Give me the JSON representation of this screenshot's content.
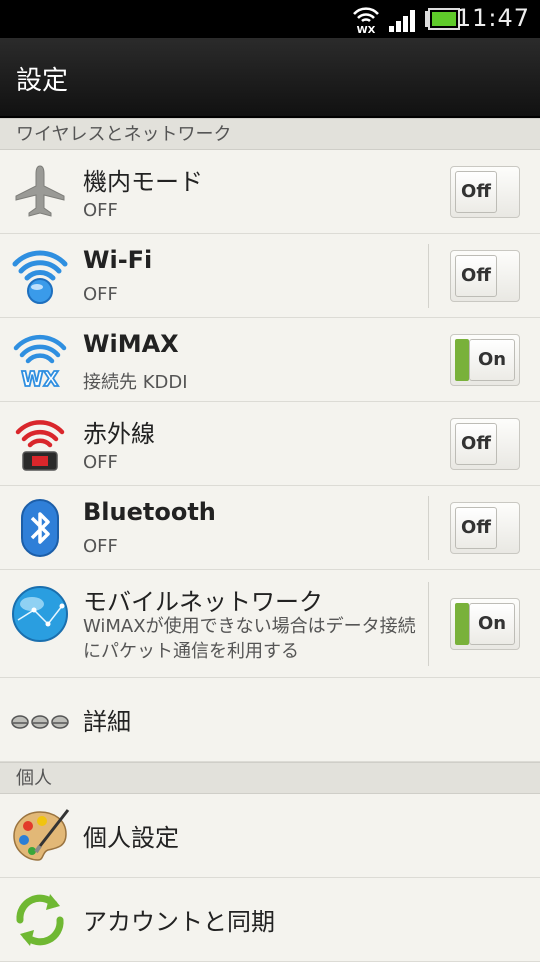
{
  "status_bar": {
    "time": "11:47",
    "network_label": "WX"
  },
  "action_bar": {
    "title": "設定"
  },
  "sections": {
    "wireless": {
      "header": "ワイヤレスとネットワーク",
      "items": [
        {
          "title": "機内モード",
          "subtitle": "OFF",
          "toggle": "Off",
          "icon": "airplane-icon"
        },
        {
          "title": "Wi-Fi",
          "subtitle": "OFF",
          "toggle": "Off",
          "icon": "wifi-icon"
        },
        {
          "title": "WiMAX",
          "subtitle": "接続先 KDDI",
          "toggle": "On",
          "icon": "wimax-icon"
        },
        {
          "title": "赤外線",
          "subtitle": "OFF",
          "toggle": "Off",
          "icon": "infrared-icon"
        },
        {
          "title": "Bluetooth",
          "subtitle": "OFF",
          "toggle": "Off",
          "icon": "bluetooth-icon"
        },
        {
          "title": "モバイルネットワーク",
          "subtitle": "WiMAXが使用できない場合はデータ接続にパケット通信を利用する",
          "toggle": "On",
          "icon": "globe-icon"
        },
        {
          "title": "詳細",
          "icon": "more-icon"
        }
      ]
    },
    "personal": {
      "header": "個人",
      "items": [
        {
          "title": "個人設定",
          "icon": "palette-icon"
        },
        {
          "title": "アカウントと同期",
          "icon": "sync-icon"
        }
      ]
    }
  },
  "colors": {
    "toggle_on": "#79b13a",
    "wifi_blue": "#2f8fe0",
    "infrared_red": "#d9262b"
  }
}
